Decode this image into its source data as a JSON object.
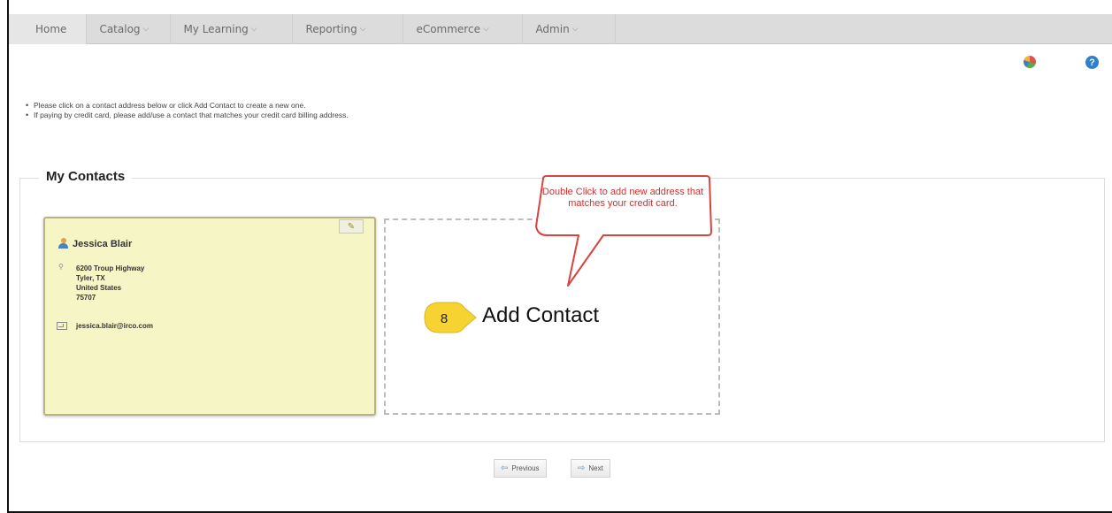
{
  "nav": {
    "items": [
      {
        "label": "Home",
        "has_dropdown": false
      },
      {
        "label": "Catalog",
        "has_dropdown": true
      },
      {
        "label": "My Learning",
        "has_dropdown": true
      },
      {
        "label": "Reporting",
        "has_dropdown": true
      },
      {
        "label": "eCommerce",
        "has_dropdown": true
      },
      {
        "label": "Admin",
        "has_dropdown": true
      }
    ],
    "chevron": "⌵"
  },
  "toolbar": {
    "chart_icon": "pie-chart-icon",
    "help_icon": "help-icon",
    "help_glyph": "?"
  },
  "instructions": [
    "Please click on a contact address below or click Add Contact to create a new one.",
    "If paying by credit card, please add/use a contact that matches your credit card billing address."
  ],
  "contacts": {
    "title": "My Contacts",
    "items": [
      {
        "name": "Jessica Blair",
        "address_lines": [
          "6200 Troup Highway",
          "Tyler, TX",
          "United States",
          "75707"
        ],
        "email": "jessica.blair@irco.com"
      }
    ],
    "add_label": "Add Contact"
  },
  "annotation": {
    "step": "8",
    "callout": "Double Click to add new address that matches your credit card.",
    "colors": {
      "callout_border": "#d64541",
      "callout_text": "#d0312f",
      "badge": "#f6d330"
    }
  },
  "pager": {
    "previous": "Previous",
    "next": "Next"
  }
}
